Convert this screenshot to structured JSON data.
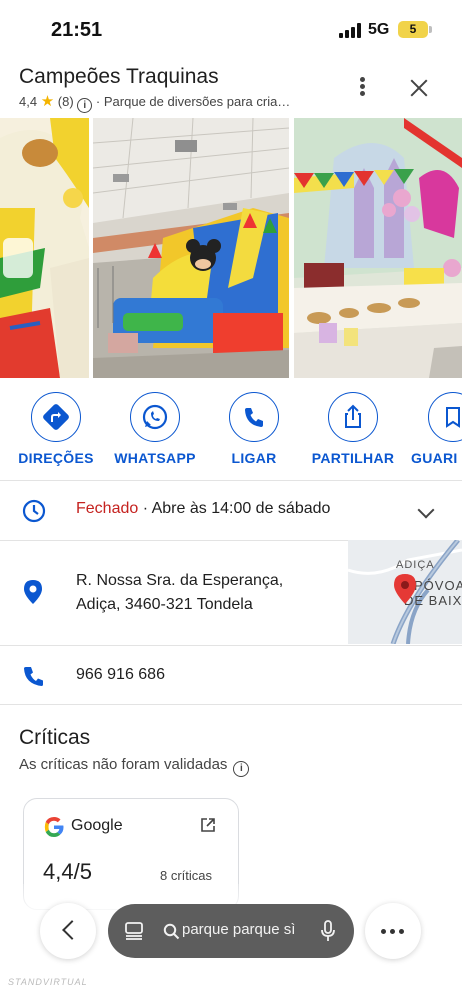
{
  "status_bar": {
    "time": "21:51",
    "network": "5G",
    "battery": "5"
  },
  "place": {
    "name": "Campeões Traquinas",
    "rating": "4,4",
    "review_count": "(8)",
    "category": "Parque de diversões para cria…",
    "info_glyph": "i"
  },
  "photos": [
    {
      "icon": "inflatable-photo"
    },
    {
      "icon": "bouncy-castle-photo"
    },
    {
      "icon": "party-table-photo"
    }
  ],
  "actions": [
    {
      "label": "DIREÇÕES",
      "icon": "directions-icon"
    },
    {
      "label": "WHATSAPP",
      "icon": "whatsapp-icon"
    },
    {
      "label": "LIGAR",
      "icon": "phone-icon"
    },
    {
      "label": "PARTILHAR",
      "icon": "share-icon"
    },
    {
      "label": "GUARI",
      "icon": "bookmark-icon"
    }
  ],
  "hours": {
    "status": "Fechado",
    "separator": " · ",
    "detail": "Abre às 14:00 de sábado"
  },
  "address": {
    "line1": "R. Nossa Sra. da Esperança,",
    "line2": "Adiça, 3460-321 Tondela",
    "map_label_1": "ADIÇA",
    "map_label_2": "PÓVOA",
    "map_label_3": "DE BAIX"
  },
  "phone": {
    "number": "966 916 686"
  },
  "reviews": {
    "title": "Críticas",
    "subtitle": "As críticas não foram validadas",
    "info_glyph": "i",
    "source_card": {
      "name": "Google",
      "score": "4,4/5",
      "count": "8 críticas"
    }
  },
  "bottom_bar": {
    "search_text": "parque parque sì"
  },
  "watermark": "STANDVIRTUAL"
}
